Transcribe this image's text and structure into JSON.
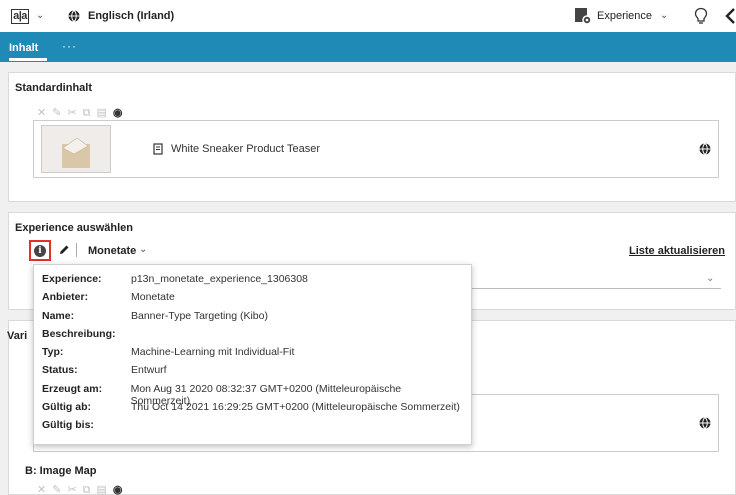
{
  "topbar": {
    "logo": "a|a",
    "language": "Englisch (Irland)",
    "experience_label": "Experience"
  },
  "tabs": [
    {
      "label": "Inhalt"
    },
    {
      "label": "···"
    }
  ],
  "standard_content": {
    "title": "Standardinhalt",
    "item_title": "White Sneaker Product Teaser"
  },
  "experience_select": {
    "title": "Experience auswählen",
    "provider": "Monetate",
    "refresh_link": "Liste aktualisieren"
  },
  "variants": {
    "title_partial": "Vari",
    "b_title": "B: Image Map"
  },
  "info_popup": {
    "rows": [
      {
        "label": "Experience:",
        "value": "p13n_monetate_experience_1306308"
      },
      {
        "label": "Anbieter:",
        "value": "Monetate"
      },
      {
        "label": "Name:",
        "value": "Banner-Type Targeting (Kibo)"
      },
      {
        "label": "Beschreibung:",
        "value": ""
      },
      {
        "label": "Typ:",
        "value": "Machine-Learning mit Individual-Fit"
      },
      {
        "label": "Status:",
        "value": "Entwurf"
      },
      {
        "label": "Erzeugt am:",
        "value": "Mon Aug 31 2020 08:32:37 GMT+0200 (Mitteleuropäische Sommerzeit)"
      },
      {
        "label": "Gültig ab:",
        "value": "Thu Oct 14 2021 16:29:25 GMT+0200 (Mitteleuropäische Sommerzeit)"
      },
      {
        "label": "Gültig bis:",
        "value": ""
      }
    ]
  },
  "colors": {
    "tabbar": "#1f8ab5",
    "highlight": "#e0302a"
  }
}
